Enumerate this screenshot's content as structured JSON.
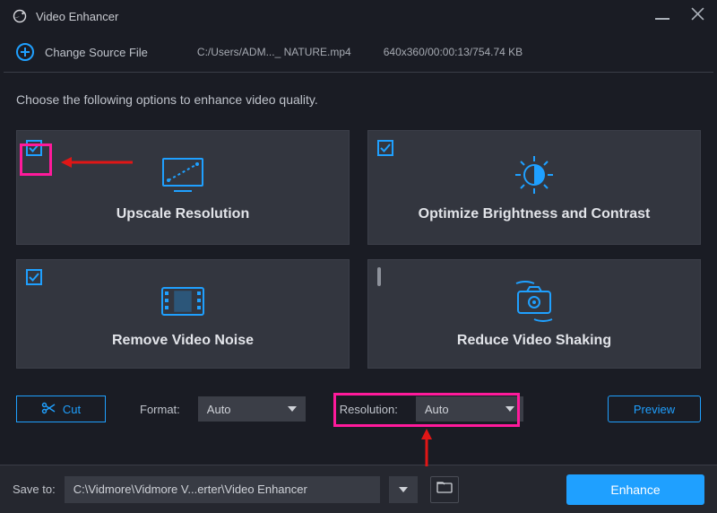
{
  "titlebar": {
    "title": "Video Enhancer"
  },
  "toolbar": {
    "change_source_label": "Change Source File",
    "file_path": "C:/Users/ADM..._ NATURE.mp4",
    "file_meta": "640x360/00:00:13/754.74 KB"
  },
  "instruction": "Choose the following options to enhance video quality.",
  "cards": {
    "upscale": {
      "label": "Upscale Resolution",
      "checked": true
    },
    "brightness": {
      "label": "Optimize Brightness and Contrast",
      "checked": true
    },
    "noise": {
      "label": "Remove Video Noise",
      "checked": true
    },
    "shaking": {
      "label": "Reduce Video Shaking",
      "checked": false
    }
  },
  "controls": {
    "cut_label": "Cut",
    "format_label": "Format:",
    "format_value": "Auto",
    "resolution_label": "Resolution:",
    "resolution_value": "Auto",
    "preview_label": "Preview"
  },
  "footer": {
    "save_to_label": "Save to:",
    "path": "C:\\Vidmore\\Vidmore V...erter\\Video Enhancer",
    "enhance_label": "Enhance"
  },
  "annotations": {
    "highlight_checkbox": true,
    "arrow_color": "#e11616",
    "highlight_resolution": true
  }
}
